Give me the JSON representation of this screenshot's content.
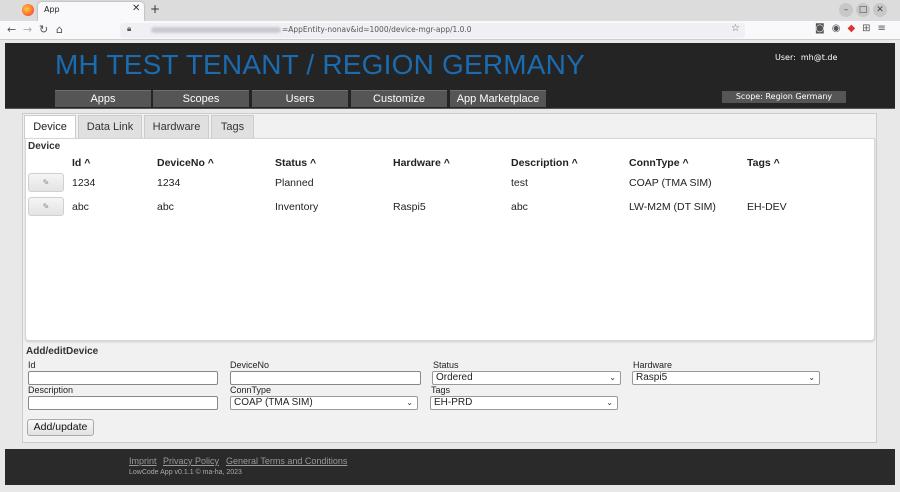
{
  "browser": {
    "tab_title": "App",
    "url_text": "=AppEntity-nonav&id=1000/device-mgr-app/1.0.0"
  },
  "header": {
    "title": "MH TEST TENANT / REGION GERMANY",
    "user_label": "User:",
    "user_value": "mh@t.de",
    "menu": [
      "Apps",
      "Scopes",
      "Users",
      "Customize",
      "App Marketplace"
    ],
    "scope": "Scope: Region Germany"
  },
  "tabs": [
    "Device",
    "Data Link",
    "Hardware",
    "Tags"
  ],
  "device_table": {
    "heading": "Device",
    "columns": [
      "Id ^",
      "DeviceNo ^",
      "Status ^",
      "Hardware ^",
      "Description ^",
      "ConnType ^",
      "Tags ^"
    ],
    "rows": [
      {
        "id": "1234",
        "device_no": "1234",
        "status": "Planned",
        "hardware": "",
        "description": "test",
        "conn_type": "COAP (TMA SIM)",
        "tags": ""
      },
      {
        "id": "abc",
        "device_no": "abc",
        "status": "Inventory",
        "hardware": "Raspi5",
        "description": "abc",
        "conn_type": "LW-M2M (DT SIM)",
        "tags": "EH-DEV"
      }
    ]
  },
  "form": {
    "heading": "Add/editDevice",
    "labels": {
      "id": "Id",
      "device_no": "DeviceNo",
      "status": "Status",
      "hardware": "Hardware",
      "description": "Description",
      "conn_type": "ConnType",
      "tags": "Tags"
    },
    "values": {
      "status": "Ordered",
      "hardware": "Raspi5",
      "conn_type": "COAP (TMA SIM)",
      "tags": "EH-PRD"
    },
    "submit": "Add/update"
  },
  "footer": {
    "links": [
      "Imprint",
      "Privacy Policy",
      "General Terms and Conditions"
    ],
    "copyright": "LowCode App v0.1.1 © ma-ha, 2023"
  },
  "colors": {
    "title_blue": "#1a6bb0",
    "header_bg": "#242424",
    "menu_bg": "#555555"
  },
  "icons": [
    "firefox-logo-icon",
    "lock-icon",
    "star-icon",
    "pencil-icon",
    "chevron-down-icon"
  ]
}
